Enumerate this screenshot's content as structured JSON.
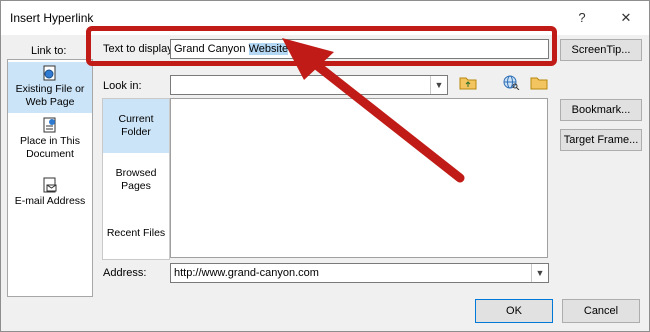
{
  "dialog": {
    "title": "Insert Hyperlink",
    "help_glyph": "?",
    "close_glyph": "✕"
  },
  "link_to": {
    "label": "Link to:",
    "items": [
      {
        "label_line1": "Existing File or",
        "label_line2": "Web Page",
        "icon": "web-page-icon",
        "selected": true
      },
      {
        "label_line1": "Place in This",
        "label_line2": "Document",
        "icon": "document-place-icon",
        "selected": false
      },
      {
        "label_line1": "E-mail Address",
        "label_line2": "",
        "icon": "email-icon",
        "selected": false
      }
    ]
  },
  "text_to_display": {
    "label": "Text to display:",
    "value_plain": "Grand Canyon ",
    "value_selected": "Website"
  },
  "screentip_button": "ScreenTip...",
  "look_in": {
    "label": "Look in:",
    "value": ""
  },
  "browse_icons": [
    "folder-up-icon",
    "browse-web-icon",
    "browse-file-icon"
  ],
  "location_list": [
    {
      "line1": "Current",
      "line2": "Folder",
      "selected": true
    },
    {
      "line1": "Browsed",
      "line2": "Pages",
      "selected": false
    },
    {
      "line1": "Recent Files",
      "line2": "",
      "selected": false
    }
  ],
  "side_buttons": {
    "bookmark": "Bookmark...",
    "target_frame": "Target Frame..."
  },
  "address": {
    "label": "Address:",
    "value": "http://www.grand-canyon.com"
  },
  "footer": {
    "ok": "OK",
    "cancel": "Cancel"
  },
  "annotation": {
    "color": "#c11b17"
  }
}
